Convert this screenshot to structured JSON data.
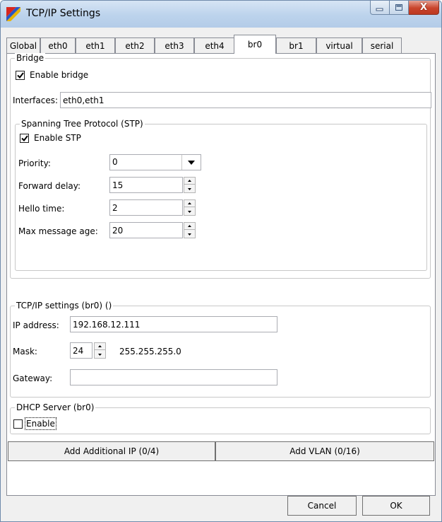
{
  "window": {
    "title": "TCP/IP Settings",
    "close_glyph": "X"
  },
  "tabs": [
    {
      "label": "Global",
      "active": false
    },
    {
      "label": "eth0",
      "active": false
    },
    {
      "label": "eth1",
      "active": false
    },
    {
      "label": "eth2",
      "active": false
    },
    {
      "label": "eth3",
      "active": false
    },
    {
      "label": "eth4",
      "active": false
    },
    {
      "label": "br0",
      "active": true
    },
    {
      "label": "br1",
      "active": false
    },
    {
      "label": "virtual",
      "active": false
    },
    {
      "label": "serial",
      "active": false
    }
  ],
  "bridge": {
    "legend": "Bridge",
    "enable_label": "Enable bridge",
    "enable_checked": true,
    "interfaces_label": "Interfaces:",
    "interfaces_value": "eth0,eth1"
  },
  "stp": {
    "legend": "Spanning Tree Protocol (STP)",
    "enable_label": "Enable STP",
    "enable_checked": true,
    "priority_label": "Priority:",
    "priority_value": "0",
    "forward_delay_label": "Forward delay:",
    "forward_delay_value": "15",
    "hello_time_label": "Hello time:",
    "hello_time_value": "2",
    "max_age_label": "Max message age:",
    "max_age_value": "20"
  },
  "tcpip": {
    "legend": "TCP/IP settings (br0) ()",
    "ip_label": "IP address:",
    "ip_value": "192.168.12.111",
    "mask_label": "Mask:",
    "mask_value": "24",
    "mask_dotted": "255.255.255.0",
    "gateway_label": "Gateway:",
    "gateway_value": ""
  },
  "dhcp": {
    "legend": "DHCP Server (br0)",
    "enable_label": "Enable",
    "enable_checked": false
  },
  "buttons": {
    "add_ip": "Add Additional IP (0/4)",
    "add_vlan": "Add VLAN (0/16)",
    "cancel": "Cancel",
    "ok": "OK"
  }
}
